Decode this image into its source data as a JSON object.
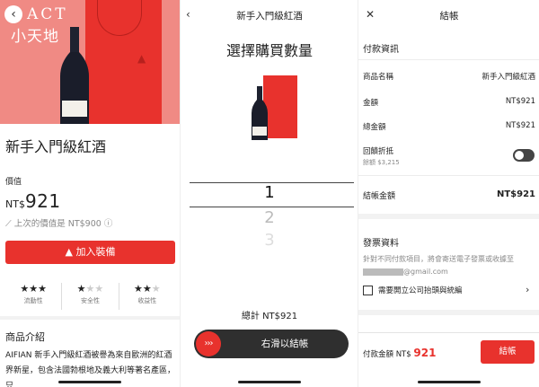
{
  "accent": "#e8322d",
  "product_screen": {
    "back_icon": "chevron-left-icon",
    "brand_line1": "ACT",
    "brand_line2": "小天地",
    "title": "新手入門級紅酒",
    "value_label": "價值",
    "price_currency": "NT$",
    "price": "921",
    "last_price": "上次的價值是 NT$900",
    "cta_label": "加入裝備",
    "ratings": [
      {
        "label": "流動性",
        "stars": 3
      },
      {
        "label": "安全性",
        "stars": 1
      },
      {
        "label": "收益性",
        "stars": 2
      }
    ],
    "rating_max": 3,
    "intro_heading": "商品介紹",
    "intro_text": "AIFIAN 新手入門級紅酒被譽為來自歐洲的紅酒界新星，包含法國勃根地及義大利等著名產區，只"
  },
  "quantity_screen": {
    "title": "新手入門級紅酒",
    "heading": "選擇購買數量",
    "options": [
      "1",
      "2",
      "3"
    ],
    "selected": "1",
    "total": "總計 NT$921",
    "slider_label": "右滑以結帳",
    "slider_knob": "›››"
  },
  "checkout_screen": {
    "title": "結帳",
    "payment_section": "付款資訊",
    "rows": [
      {
        "label": "商品名稱",
        "value": "新手入門級紅酒"
      },
      {
        "label": "金額",
        "value": "NT$921"
      },
      {
        "label": "總金額",
        "value": "NT$921"
      }
    ],
    "rebate_label": "回饋折抵",
    "rebate_balance": "餘額 $3,215",
    "rebate_enabled": false,
    "final_label": "結帳金額",
    "final_value": "NT$921",
    "invoice_section": "發票資料",
    "invoice_note": "針對不同付款項目，將會寄送電子發票或收據至",
    "email_suffix": "@gmail.com",
    "company_checkbox_label": "需要開立公司抬頭與統編",
    "pay_label": "付款金額 NT$",
    "pay_amount": "921",
    "checkout_button": "結帳"
  }
}
